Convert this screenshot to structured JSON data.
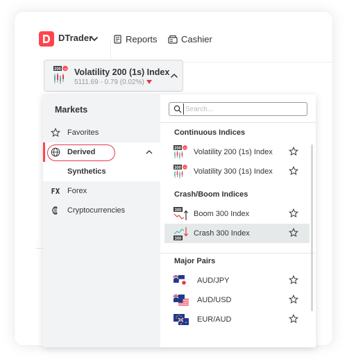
{
  "header": {
    "brand": "DTrader",
    "nav": [
      {
        "label": "Reports",
        "icon": "reports-icon"
      },
      {
        "label": "Cashier",
        "icon": "cashier-icon"
      }
    ]
  },
  "selector": {
    "name": "Volatility 200 (1s) Index",
    "badge": "200",
    "badge_sub": "1s",
    "price": "5111.69 - 0.79 (0.02%)",
    "trend": "down"
  },
  "sidebar": {
    "title": "Markets",
    "items": [
      {
        "label": "Favorites",
        "icon": "star-icon"
      },
      {
        "label": "Derived",
        "icon": "globe-icon",
        "selected": true
      },
      {
        "label": "Synthetics",
        "sub": true
      },
      {
        "label": "Forex",
        "icon": "forex-icon"
      },
      {
        "label": "Cryptocurrencies",
        "icon": "crypto-icon"
      }
    ]
  },
  "search": {
    "placeholder": "Search...",
    "value": ""
  },
  "sections": [
    {
      "title": "Continuous Indices",
      "rows": [
        {
          "name": "Volatility 200 (1s) Index",
          "badge": "200",
          "badge_sub": "1s"
        },
        {
          "name": "Volatility 300 (1s) Index",
          "badge": "300",
          "badge_sub": "1s"
        }
      ]
    },
    {
      "title": "Crash/Boom Indices",
      "rows": [
        {
          "name": "Boom 300 Index",
          "badge": "300"
        },
        {
          "name": "Crash 300 Index",
          "badge": "300",
          "active": true
        }
      ]
    },
    {
      "title": "Major Pairs",
      "rows": [
        {
          "name": "AUD/JPY"
        },
        {
          "name": "AUD/USD"
        },
        {
          "name": "EUR/AUD"
        }
      ]
    }
  ],
  "colors": {
    "accent": "#ff444f",
    "sidebar_bg": "#f2f3f4",
    "active_row": "#e6e9e9",
    "text": "#333333",
    "muted": "#999999"
  }
}
